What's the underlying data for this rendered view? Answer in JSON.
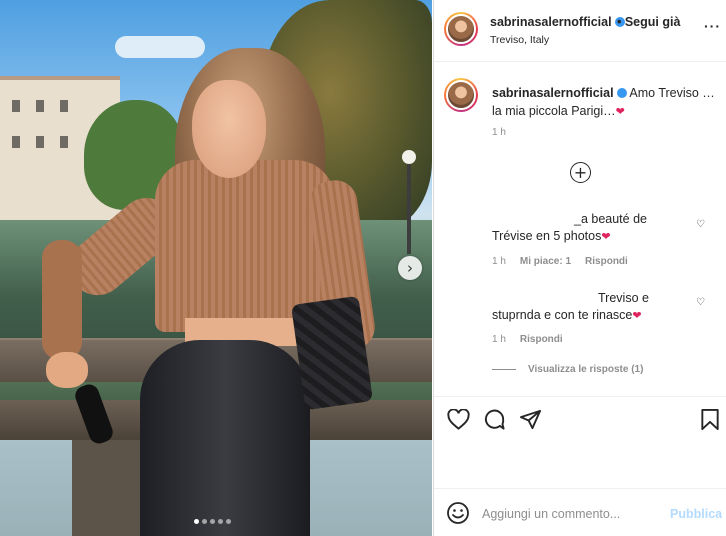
{
  "post": {
    "username": "sabrinasalernofficial",
    "follow_label": "• Segui già",
    "location": "Treviso, Italy",
    "more_label": "···",
    "carousel": {
      "slide_count": 5,
      "active_index": 0,
      "next_icon": "chevron-right-icon"
    }
  },
  "caption": {
    "username": "sabrinasalernofficial",
    "text_line1": "Amo Treviso …",
    "text_line2": "la mia piccola Parigi…",
    "emoji": "❤",
    "time": "1 h",
    "load_more_icon": "plus-circle-icon"
  },
  "comments": [
    {
      "line1": "_a beauté de",
      "line2": "Trévise en 5 photos",
      "emoji": "❤",
      "time": "1 h",
      "likes": "Mi piace: 1",
      "reply": "Rispondi",
      "like_icon": "♡"
    },
    {
      "line1": "Treviso e",
      "line2": "stuprnda e con te rinasce",
      "emoji": "❤",
      "time": "1 h",
      "reply": "Rispondi",
      "like_icon": "♡"
    }
  ],
  "view_replies": "Visualizza le risposte (1)",
  "actions": [
    "heart-icon",
    "comment-icon",
    "share-icon",
    "bookmark-icon"
  ],
  "composer": {
    "placeholder": "Aggiungi un commento...",
    "publish_label": "Pubblica",
    "emoji_icon": "smiley-icon"
  },
  "colors": {
    "link_disabled": "#b3dbff",
    "verified": "#3897f0",
    "heart": "#e0245e",
    "muted": "#8e8e8e"
  }
}
